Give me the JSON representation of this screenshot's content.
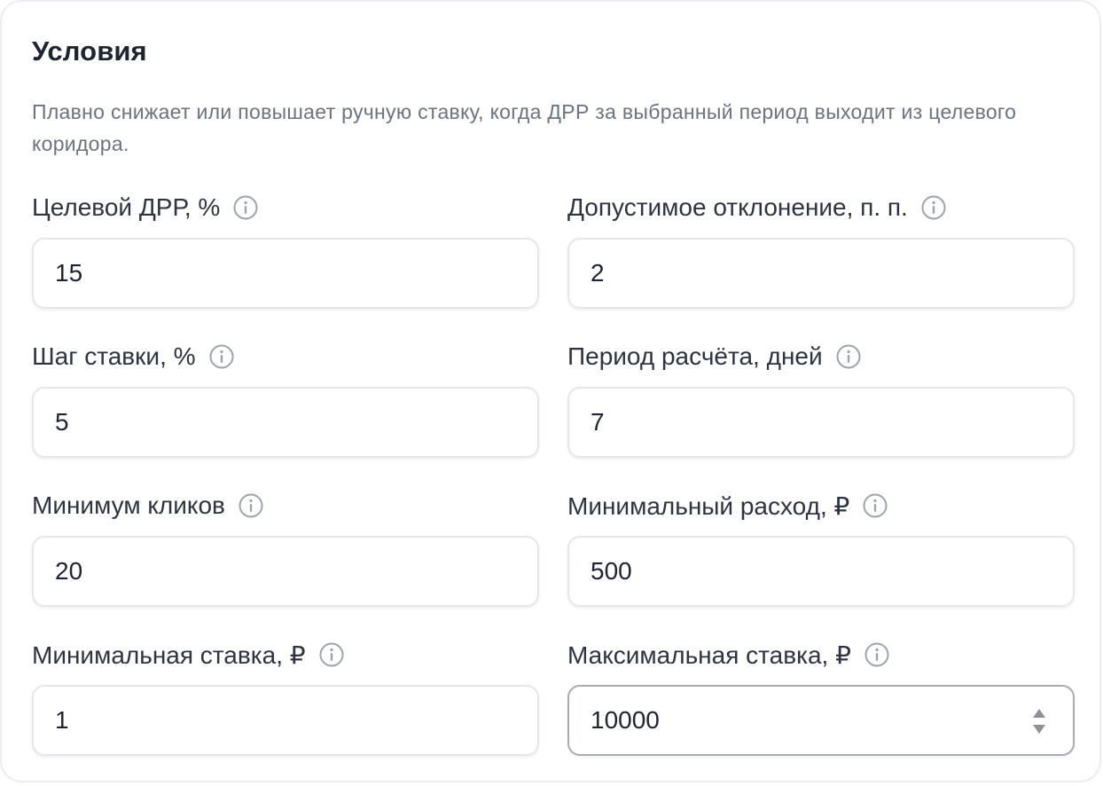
{
  "section": {
    "title": "Условия",
    "description": "Плавно снижает или повышает ручную ставку, когда ДРР за выбранный период выходит из целевого коридора."
  },
  "fields": [
    {
      "label": "Целевой ДРР, %",
      "value": "15"
    },
    {
      "label": "Допустимое отклонение, п. п.",
      "value": "2"
    },
    {
      "label": "Шаг ставки, %",
      "value": "5"
    },
    {
      "label": "Период расчёта, дней",
      "value": "7"
    },
    {
      "label": "Минимум кликов",
      "value": "20"
    },
    {
      "label": "Минимальный расход, ₽",
      "value": "500"
    },
    {
      "label": "Минимальная ставка, ₽",
      "value": "1"
    },
    {
      "label": "Максимальная ставка, ₽",
      "value": "10000"
    }
  ],
  "icons": {
    "info": "info-circle-icon",
    "stepper": "stepper-arrows-icon"
  },
  "colors": {
    "text": "#1f2433",
    "muted": "#6b7280",
    "border": "#e5e7eb",
    "focused_border": "#a8acb3",
    "icon": "#9ca3af"
  }
}
